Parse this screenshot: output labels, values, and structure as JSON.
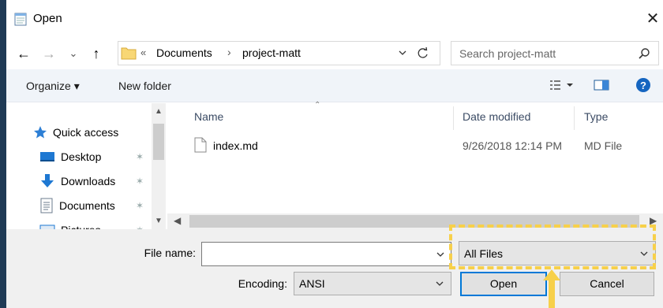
{
  "window": {
    "title": "Open",
    "close_glyph": "✕"
  },
  "nav": {
    "back_glyph": "←",
    "forward_glyph": "→",
    "recent_glyph": "⌄",
    "up_glyph": "↑",
    "address": {
      "overflow_glyph": "«",
      "separator": "›",
      "crumbs": [
        "Documents",
        "project-matt"
      ]
    },
    "search": {
      "placeholder": "Search project-matt"
    }
  },
  "toolbar": {
    "organize_label": "Organize ▾",
    "new_folder_label": "New folder"
  },
  "sidebar": {
    "items": [
      {
        "label": "Quick access",
        "icon": "star-icon",
        "pinned": false
      },
      {
        "label": "Desktop",
        "icon": "desktop-icon",
        "pinned": true
      },
      {
        "label": "Downloads",
        "icon": "download-icon",
        "pinned": true
      },
      {
        "label": "Documents",
        "icon": "documents-icon",
        "pinned": true
      },
      {
        "label": "Pictures",
        "icon": "pictures-icon",
        "pinned": true
      }
    ],
    "pin_glyph": "✶"
  },
  "file_list": {
    "columns": {
      "name": "Name",
      "date": "Date modified",
      "type": "Type"
    },
    "rows": [
      {
        "name": "index.md",
        "date": "9/26/2018 12:14 PM",
        "type": "MD File"
      }
    ]
  },
  "footer": {
    "file_name_label": "File name:",
    "file_name_value": "",
    "file_type_value": "All Files",
    "encoding_label": "Encoding:",
    "encoding_value": "ANSI",
    "open_label": "Open",
    "cancel_label": "Cancel"
  },
  "colors": {
    "accent": "#0078d7",
    "highlight": "#f7d04a",
    "toolbar_bg": "#f0f4f9"
  }
}
